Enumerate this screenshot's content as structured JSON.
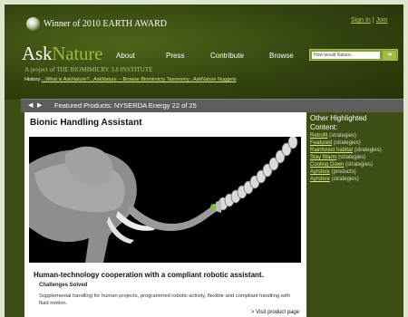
{
  "header": {
    "award": "Winner of 2010 EARTH AWARD",
    "signin": "Sign In",
    "join": "Join",
    "signin_sep": "|",
    "logo_a": "Ask",
    "logo_b": "Nature",
    "project_prefix": "A project of",
    "project_name": "THE BIOMIMICRY 3.8 INSTITUTE"
  },
  "nav": {
    "items": [
      "About",
      "Press",
      "Contribute",
      "Browse"
    ]
  },
  "search": {
    "placeholder": "How would Nature...",
    "go_icon": "search-go-icon"
  },
  "history": {
    "label": "History:",
    "links": [
      "...What is AskNature?",
      "...AskNature -- Browse Biomimicry Taxonomy",
      "...AskNature Nuggets"
    ]
  },
  "featured": {
    "title": "Featured Products: NYSERDA Energy 22 of 25",
    "prev_icon": "arrow-left-icon",
    "next_icon": "arrow-right-icon"
  },
  "product": {
    "title": "Bionic Handling Assistant",
    "caption": "Human-technology cooperation with a compliant robotic assistant.",
    "subhead": "Challenges Solved",
    "description": "Supplemental handling for human projects, programmed robotic activity, flexible and compliant handling with fluid motion.",
    "visit": "> Visit product page"
  },
  "sidebar": {
    "heading": "Other Highlighted Content:",
    "items": [
      {
        "link": "Retrofit",
        "type": "(strategies)"
      },
      {
        "link": "Featured",
        "type": "(strategies)"
      },
      {
        "link": "Rainforest habitat",
        "type": "(strategies)"
      },
      {
        "link": "Stay Warm",
        "type": "(strategies)"
      },
      {
        "link": "Cooling Down",
        "type": "(strategies)"
      },
      {
        "link": "Ayrshire",
        "type": "(products)"
      },
      {
        "link": "Ayrshire",
        "type": "(strategies)"
      }
    ]
  }
}
